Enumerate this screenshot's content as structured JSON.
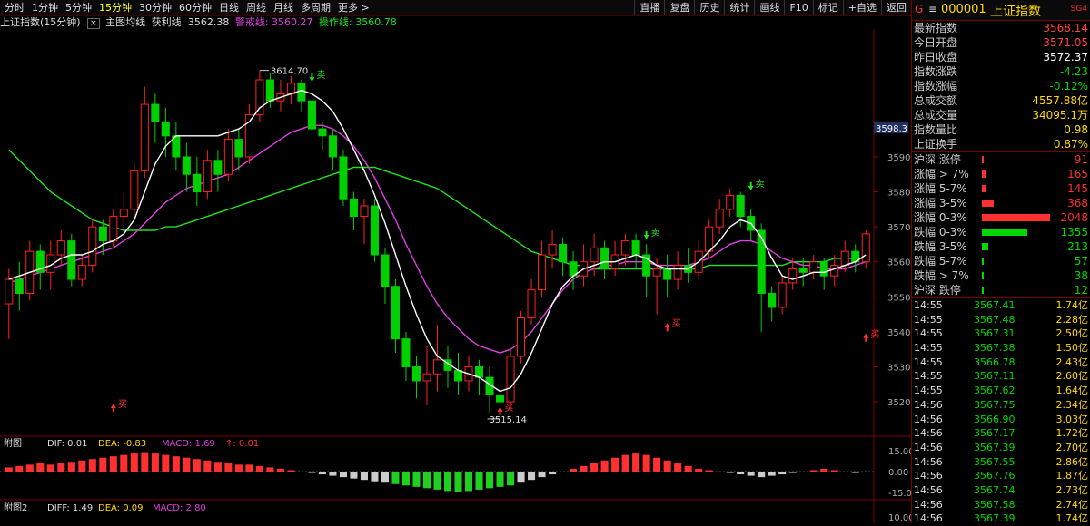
{
  "toolbar": {
    "tabs": [
      "分时",
      "1分钟",
      "5分钟",
      "15分钟",
      "30分钟",
      "60分钟",
      "日线",
      "周线",
      "月线",
      "多周期",
      "更多"
    ],
    "active_tab": "15分钟",
    "right_buttons": [
      "直播",
      "复盘",
      "历史",
      "统计",
      "画线",
      "F10",
      "标记",
      "+自选",
      "返回"
    ]
  },
  "chart_header": {
    "title": "上证指数(15分钟)",
    "indicator": "主图均线",
    "profit_label": "获利线: 3562.38",
    "warn_label": "警戒线: 3560.27",
    "op_label": "操作线: 3560.78"
  },
  "chart_data": [
    {
      "type": "candlestick",
      "title": "上证指数(15分钟)",
      "ylim": [
        3512,
        3626
      ],
      "y_ticks": [
        3520,
        3530,
        3540,
        3550,
        3560,
        3570,
        3580,
        3590
      ],
      "current_price_label": "3598.3",
      "high_label": "3614.70",
      "low_label": "3515.14",
      "candles": [
        [
          3548,
          3555,
          3538,
          3558
        ],
        [
          3555,
          3551,
          3546,
          3560
        ],
        [
          3551,
          3563,
          3549,
          3566
        ],
        [
          3563,
          3557,
          3552,
          3565
        ],
        [
          3557,
          3562,
          3552,
          3566
        ],
        [
          3562,
          3566,
          3559,
          3569
        ],
        [
          3566,
          3555,
          3553,
          3568
        ],
        [
          3555,
          3559,
          3553,
          3562
        ],
        [
          3559,
          3570,
          3557,
          3572
        ],
        [
          3570,
          3566,
          3562,
          3572
        ],
        [
          3566,
          3573,
          3564,
          3575
        ],
        [
          3573,
          3575,
          3568,
          3580
        ],
        [
          3575,
          3586,
          3573,
          3588
        ],
        [
          3586,
          3605,
          3584,
          3610
        ],
        [
          3605,
          3600,
          3594,
          3608
        ],
        [
          3600,
          3596,
          3590,
          3604
        ],
        [
          3596,
          3590,
          3586,
          3600
        ],
        [
          3590,
          3585,
          3580,
          3594
        ],
        [
          3585,
          3580,
          3576,
          3590
        ],
        [
          3580,
          3589,
          3578,
          3592
        ],
        [
          3589,
          3585,
          3580,
          3592
        ],
        [
          3585,
          3595,
          3583,
          3598
        ],
        [
          3595,
          3590,
          3586,
          3598
        ],
        [
          3590,
          3602,
          3588,
          3605
        ],
        [
          3602,
          3612,
          3600,
          3614.7
        ],
        [
          3612,
          3606,
          3604,
          3614
        ],
        [
          3606,
          3608,
          3603,
          3612
        ],
        [
          3608,
          3611,
          3605,
          3613
        ],
        [
          3611,
          3606,
          3603,
          3612
        ],
        [
          3606,
          3598,
          3596,
          3608
        ],
        [
          3598,
          3596,
          3592,
          3600
        ],
        [
          3596,
          3590,
          3586,
          3598
        ],
        [
          3590,
          3578,
          3576,
          3592
        ],
        [
          3578,
          3573,
          3569,
          3580
        ],
        [
          3573,
          3576,
          3565,
          3578
        ],
        [
          3576,
          3562,
          3560,
          3578
        ],
        [
          3562,
          3553,
          3548,
          3564
        ],
        [
          3553,
          3538,
          3534,
          3555
        ],
        [
          3538,
          3530,
          3526,
          3540
        ],
        [
          3530,
          3526,
          3521,
          3533
        ],
        [
          3526,
          3528,
          3519,
          3536
        ],
        [
          3528,
          3532,
          3523,
          3542
        ],
        [
          3532,
          3529,
          3524,
          3536
        ],
        [
          3529,
          3526,
          3522,
          3534
        ],
        [
          3526,
          3530,
          3523,
          3533
        ],
        [
          3530,
          3527,
          3522,
          3532
        ],
        [
          3527,
          3522,
          3517,
          3530
        ],
        [
          3522,
          3520,
          3515.14,
          3528
        ],
        [
          3520,
          3533,
          3518,
          3535
        ],
        [
          3533,
          3544,
          3531,
          3546
        ],
        [
          3544,
          3552,
          3542,
          3555
        ],
        [
          3552,
          3562,
          3550,
          3566
        ],
        [
          3562,
          3565,
          3558,
          3569
        ],
        [
          3565,
          3560,
          3556,
          3567
        ],
        [
          3560,
          3556,
          3552,
          3563
        ],
        [
          3556,
          3560,
          3553,
          3565
        ],
        [
          3560,
          3564,
          3556,
          3568
        ],
        [
          3564,
          3558,
          3555,
          3566
        ],
        [
          3558,
          3562,
          3556,
          3566
        ],
        [
          3562,
          3566,
          3559,
          3568
        ],
        [
          3566,
          3562,
          3558,
          3568
        ],
        [
          3562,
          3556,
          3550,
          3565
        ],
        [
          3556,
          3558,
          3545,
          3561
        ],
        [
          3558,
          3555,
          3550,
          3562
        ],
        [
          3555,
          3559,
          3552,
          3563
        ],
        [
          3559,
          3557,
          3554,
          3564
        ],
        [
          3557,
          3563,
          3555,
          3566
        ],
        [
          3563,
          3570,
          3561,
          3572
        ],
        [
          3570,
          3575,
          3568,
          3578
        ],
        [
          3575,
          3579,
          3573,
          3581
        ],
        [
          3579,
          3573,
          3570,
          3580
        ],
        [
          3573,
          3569,
          3566,
          3575
        ],
        [
          3569,
          3551,
          3540,
          3571
        ],
        [
          3551,
          3547,
          3543,
          3553
        ],
        [
          3547,
          3554,
          3545,
          3556
        ],
        [
          3554,
          3558,
          3552,
          3561
        ],
        [
          3558,
          3557,
          3553,
          3561
        ],
        [
          3557,
          3560,
          3555,
          3562
        ],
        [
          3560,
          3556,
          3552,
          3561
        ],
        [
          3556,
          3559,
          3553,
          3562
        ],
        [
          3559,
          3563,
          3557,
          3566
        ],
        [
          3563,
          3560,
          3557,
          3565
        ],
        [
          3560,
          3568,
          3558,
          3569
        ]
      ],
      "ma_fast": [
        3555,
        3556,
        3557,
        3558,
        3559,
        3561,
        3562,
        3562,
        3563,
        3565,
        3566,
        3568,
        3572,
        3580,
        3588,
        3593,
        3596,
        3596,
        3596,
        3596,
        3596,
        3597,
        3598,
        3600,
        3604,
        3606,
        3607,
        3608,
        3609,
        3608,
        3606,
        3603,
        3598,
        3592,
        3586,
        3579,
        3571,
        3562,
        3553,
        3545,
        3538,
        3533,
        3531,
        3529,
        3528,
        3527,
        3525,
        3523,
        3524,
        3528,
        3534,
        3541,
        3548,
        3553,
        3556,
        3558,
        3559,
        3560,
        3560,
        3561,
        3562,
        3561,
        3559,
        3558,
        3558,
        3558,
        3560,
        3563,
        3566,
        3570,
        3572,
        3571,
        3567,
        3561,
        3556,
        3555,
        3556,
        3557,
        3557,
        3558,
        3559,
        3560,
        3562
      ],
      "ma_mid": [
        3554,
        3555,
        3556,
        3557,
        3558,
        3559,
        3560,
        3561,
        3562,
        3563,
        3564,
        3566,
        3568,
        3571,
        3574,
        3577,
        3579,
        3581,
        3582,
        3583,
        3584,
        3585,
        3587,
        3589,
        3591,
        3593,
        3595,
        3597,
        3598,
        3599,
        3599,
        3598,
        3596,
        3593,
        3589,
        3584,
        3578,
        3572,
        3565,
        3559,
        3553,
        3548,
        3544,
        3541,
        3538,
        3536,
        3535,
        3534,
        3535,
        3537,
        3540,
        3544,
        3548,
        3552,
        3555,
        3557,
        3558,
        3559,
        3559,
        3560,
        3560,
        3560,
        3559,
        3559,
        3559,
        3559,
        3560,
        3561,
        3563,
        3565,
        3566,
        3566,
        3565,
        3563,
        3561,
        3560,
        3559,
        3559,
        3558,
        3558,
        3558,
        3559,
        3560
      ],
      "ma_slow": [
        3592,
        3589,
        3586,
        3583,
        3580,
        3578,
        3576,
        3574,
        3572,
        3571,
        3570,
        3569,
        3569,
        3569,
        3569,
        3570,
        3570,
        3571,
        3572,
        3573,
        3574,
        3575,
        3576,
        3577,
        3578,
        3579,
        3580,
        3581,
        3582,
        3583,
        3584,
        3585,
        3586,
        3587,
        3587,
        3587,
        3586,
        3585,
        3584,
        3583,
        3582,
        3581,
        3579,
        3577,
        3575,
        3573,
        3571,
        3569,
        3567,
        3565,
        3563,
        3562,
        3561,
        3560,
        3559,
        3559,
        3558,
        3558,
        3558,
        3558,
        3558,
        3558,
        3558,
        3558,
        3558,
        3558,
        3558,
        3559,
        3559,
        3559,
        3559,
        3559,
        3559,
        3559,
        3559,
        3560,
        3560,
        3560,
        3560,
        3561,
        3561,
        3561,
        3561
      ],
      "buy_labels": [
        "买",
        "买",
        "买",
        "买"
      ],
      "sell_labels": [
        "卖",
        "卖",
        "卖"
      ]
    },
    {
      "type": "bar",
      "title": "附图",
      "ylim": [
        -17,
        17
      ],
      "y_ticks": [
        15,
        0,
        -15
      ],
      "y_tick_labels": [
        "15.00",
        "0.00",
        "-15.00"
      ],
      "dif_label": "DIF: 0.01",
      "dea_label": "DEA: -0.83",
      "macd_label": "MACD: 1.69",
      "extra_label": "↑: 0.01",
      "values": [
        3,
        4,
        5,
        6,
        5,
        6,
        7,
        8,
        9,
        10,
        11,
        12,
        13,
        14,
        13,
        12,
        11,
        10,
        9,
        8,
        7,
        6,
        5,
        5,
        4,
        3,
        2,
        1,
        0,
        -1,
        -2,
        -3,
        -4,
        -5,
        -6,
        -7,
        -8,
        -9,
        -10,
        -11,
        -12,
        -13,
        -14,
        -15,
        -14,
        -13,
        -12,
        -11,
        -10,
        -8,
        -6,
        -4,
        -2,
        0,
        2,
        4,
        6,
        8,
        10,
        12,
        13,
        12,
        10,
        8,
        6,
        4,
        2,
        1,
        0,
        -1,
        -2,
        -3,
        -4,
        -3,
        -2,
        -1,
        0,
        1,
        2,
        1,
        0,
        -1,
        0
      ]
    }
  ],
  "sub2": {
    "title": "附图2",
    "diff_label": "DIFF: 1.49",
    "dea_label": "DEA: 0.09",
    "macd_label": "MACD: 2.80",
    "y_tick": "10.00"
  },
  "right_panel": {
    "code": "000001",
    "name": "上证指数",
    "badge": "SG4",
    "stats": [
      {
        "label": "最新指数",
        "value": "3568.14",
        "color": "#ff4040"
      },
      {
        "label": "今日开盘",
        "value": "3571.05",
        "color": "#ff4040"
      },
      {
        "label": "昨日收盘",
        "value": "3572.37",
        "color": "#ffffff"
      },
      {
        "label": "指数涨跌",
        "value": "-4.23",
        "color": "#00d800"
      },
      {
        "label": "指数涨幅",
        "value": "-0.12%",
        "color": "#00d800"
      },
      {
        "label": "总成交额",
        "value": "4557.88亿",
        "color": "#ffd800"
      },
      {
        "label": "总成交量",
        "value": "34095.1万",
        "color": "#ffd800"
      },
      {
        "label": "指数量比",
        "value": "0.98",
        "color": "#ffd800"
      },
      {
        "label": "上证换手",
        "value": "0.87%",
        "color": "#ffd800"
      }
    ],
    "breadth": [
      {
        "label": "沪深 涨停",
        "value": "91",
        "bar": 0.03,
        "color": "#ff3030"
      },
      {
        "label": "涨幅 > 7%",
        "value": "165",
        "bar": 0.05,
        "color": "#ff3030"
      },
      {
        "label": "涨幅 5-7%",
        "value": "145",
        "bar": 0.05,
        "color": "#ff3030"
      },
      {
        "label": "涨幅 3-5%",
        "value": "368",
        "bar": 0.17,
        "color": "#ff3030"
      },
      {
        "label": "涨幅 0-3%",
        "value": "2048",
        "bar": 1.0,
        "color": "#ff3030"
      },
      {
        "label": "跌幅 0-3%",
        "value": "1355",
        "bar": 0.66,
        "color": "#00d800"
      },
      {
        "label": "跌幅 3-5%",
        "value": "213",
        "bar": 0.09,
        "color": "#00d800"
      },
      {
        "label": "跌幅 5-7%",
        "value": "57",
        "bar": 0.03,
        "color": "#00d800"
      },
      {
        "label": "跌幅 > 7%",
        "value": "38",
        "bar": 0.02,
        "color": "#00d800"
      },
      {
        "label": "沪深 跌停",
        "value": "12",
        "bar": 0.01,
        "color": "#00d800"
      }
    ],
    "ticks": [
      {
        "time": "14:55",
        "price": "3567.41",
        "vol": "1.74亿"
      },
      {
        "time": "14:55",
        "price": "3567.48",
        "vol": "2.28亿"
      },
      {
        "time": "14:55",
        "price": "3567.31",
        "vol": "2.50亿"
      },
      {
        "time": "14:55",
        "price": "3567.38",
        "vol": "1.50亿"
      },
      {
        "time": "14:55",
        "price": "3566.78",
        "vol": "2.43亿"
      },
      {
        "time": "14:55",
        "price": "3567.11",
        "vol": "2.60亿"
      },
      {
        "time": "14:55",
        "price": "3567.62",
        "vol": "1.64亿"
      },
      {
        "time": "14:56",
        "price": "3567.75",
        "vol": "2.34亿"
      },
      {
        "time": "14:56",
        "price": "3566.90",
        "vol": "3.03亿"
      },
      {
        "time": "14:56",
        "price": "3567.17",
        "vol": "1.72亿"
      },
      {
        "time": "14:56",
        "price": "3567.39",
        "vol": "2.70亿"
      },
      {
        "time": "14:56",
        "price": "3567.55",
        "vol": "2.86亿"
      },
      {
        "time": "14:56",
        "price": "3567.76",
        "vol": "1.87亿"
      },
      {
        "time": "14:56",
        "price": "3567.74",
        "vol": "2.73亿"
      },
      {
        "time": "14:56",
        "price": "3567.58",
        "vol": "2.74亿"
      },
      {
        "time": "14:56",
        "price": "3567.39",
        "vol": "1.74亿"
      }
    ]
  },
  "colors": {
    "up": "#ff2020",
    "down": "#00d000",
    "ma_fast": "#ffffff",
    "ma_mid": "#e040e0",
    "ma_slow": "#20e020",
    "grid": "#400000"
  }
}
